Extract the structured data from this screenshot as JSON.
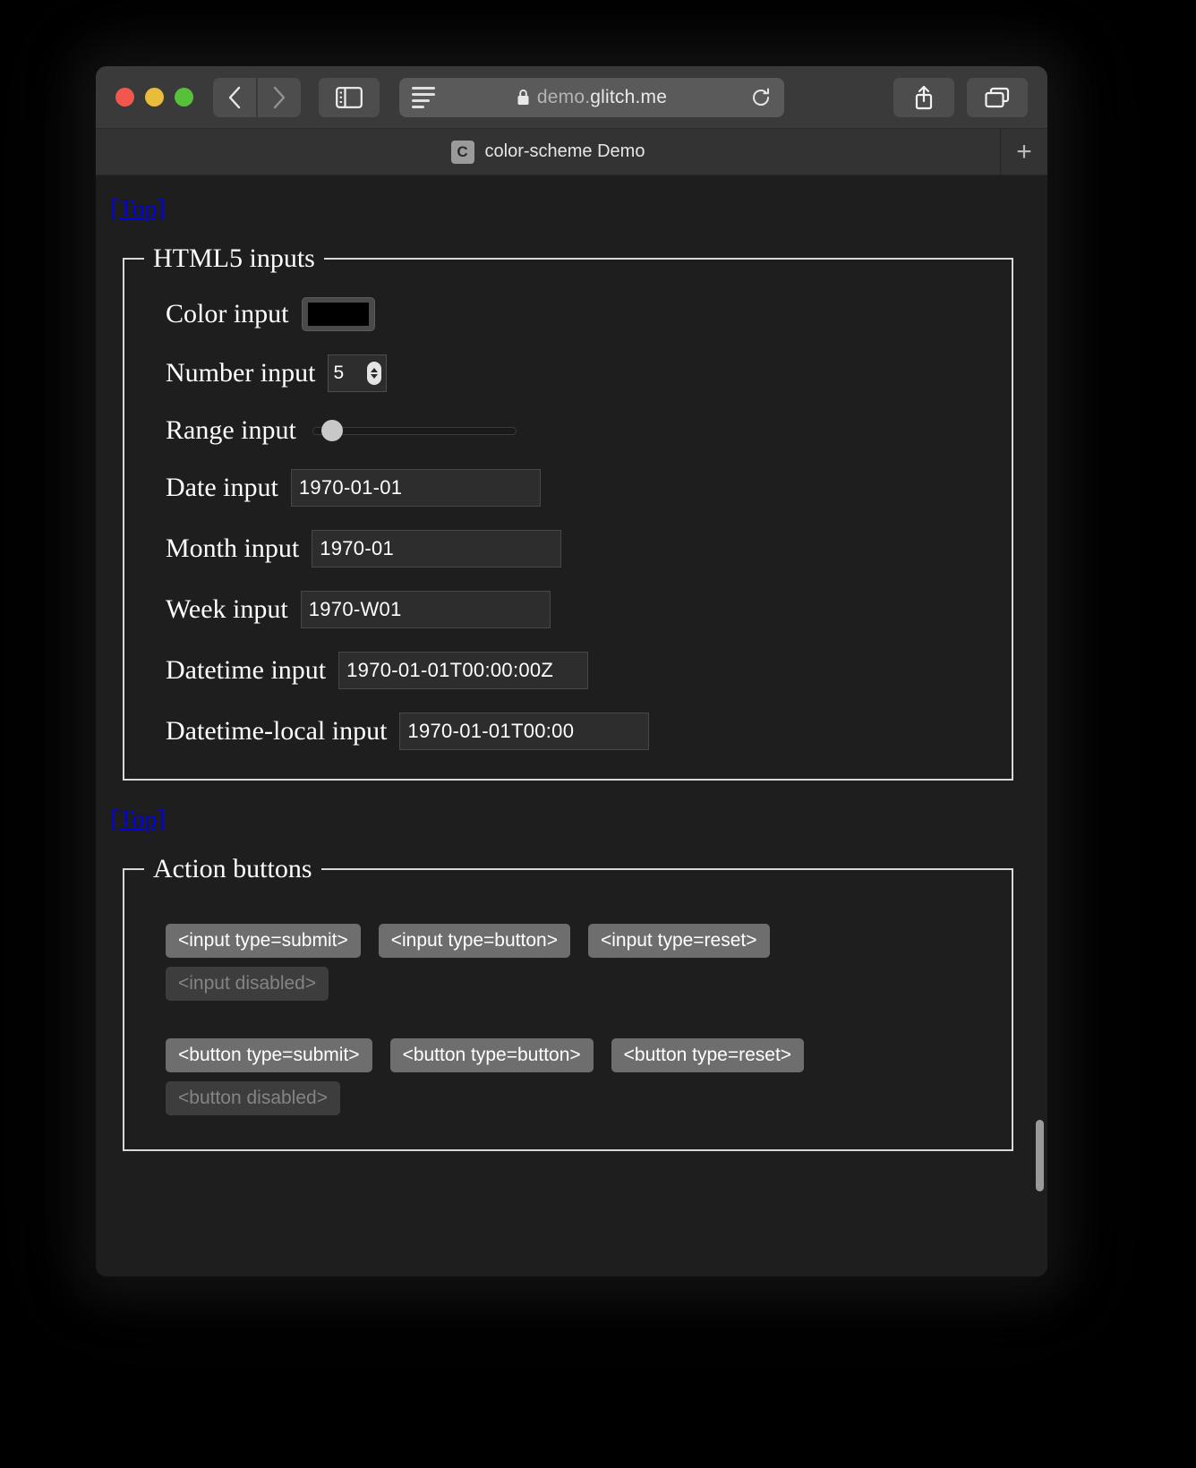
{
  "browser": {
    "traffic_lights": [
      "close",
      "minimize",
      "zoom"
    ],
    "back_label": "‹",
    "forward_label": "›",
    "sidebar_icon": "sidebar-icon",
    "reader_icon": "reader-view-icon",
    "lock_icon": "lock-icon",
    "url": "demo.glitch.me",
    "url_prefix": "demo.",
    "url_suffix": "glitch.me",
    "reload_icon": "reload-icon",
    "share_icon": "share-icon",
    "tabs_icon": "tab-overview-icon",
    "tab": {
      "favicon_letter": "C",
      "title": "color-scheme Demo"
    },
    "new_tab_label": "+"
  },
  "page": {
    "top_link_1": "[Top]",
    "top_link_2": "[Top]",
    "accent_link_color": "#0000ee",
    "background_color": "#1e1e1e",
    "text_color": "#ffffff",
    "fieldsets": [
      {
        "legend": "HTML5 inputs",
        "rows": [
          {
            "label": "Color input",
            "type": "color",
            "value": "#000000"
          },
          {
            "label": "Number input",
            "type": "number",
            "value": "5"
          },
          {
            "label": "Range input",
            "type": "range",
            "value": "0"
          },
          {
            "label": "Date input",
            "type": "date",
            "value": "1970-01-01"
          },
          {
            "label": "Month input",
            "type": "month",
            "value": "1970-01"
          },
          {
            "label": "Week input",
            "type": "week",
            "value": "1970-W01"
          },
          {
            "label": "Datetime input",
            "type": "datetime",
            "value": "1970-01-01T00:00:00Z"
          },
          {
            "label": "Datetime-local input",
            "type": "datetime-local",
            "value": "1970-01-01T00:00"
          }
        ]
      },
      {
        "legend": "Action buttons",
        "button_rows": [
          [
            {
              "label": "<input type=submit>",
              "disabled": false
            },
            {
              "label": "<input type=button>",
              "disabled": false
            },
            {
              "label": "<input type=reset>",
              "disabled": false
            }
          ],
          [
            {
              "label": "<input disabled>",
              "disabled": true
            }
          ],
          [
            {
              "label": "<button type=submit>",
              "disabled": false
            },
            {
              "label": "<button type=button>",
              "disabled": false
            },
            {
              "label": "<button type=reset>",
              "disabled": false
            }
          ],
          [
            {
              "label": "<button disabled>",
              "disabled": true
            }
          ]
        ]
      }
    ]
  }
}
